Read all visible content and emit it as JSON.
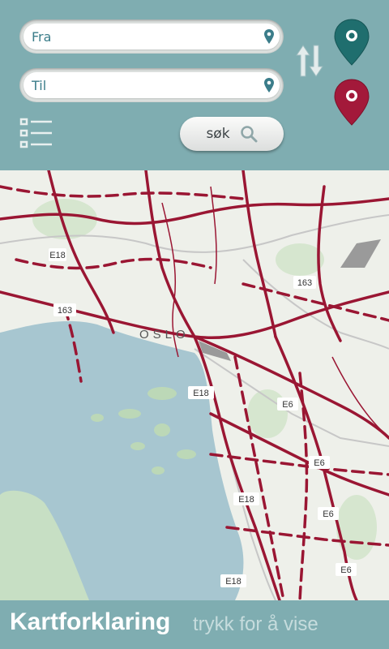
{
  "search": {
    "from_placeholder": "Fra",
    "to_placeholder": "Til",
    "search_label": "søk"
  },
  "map": {
    "city_label": "OSLO",
    "road_labels": [
      "E18",
      "E6",
      "163",
      "E18",
      "E6",
      "E18",
      "E6",
      "E18",
      "E6",
      "163"
    ]
  },
  "legend": {
    "title": "Kartforklaring",
    "hint": "trykk for å vise"
  },
  "icons": {
    "from_pin_color": "#1f6e6e",
    "to_pin_color": "#a3193a",
    "route_color": "#9a1633"
  }
}
